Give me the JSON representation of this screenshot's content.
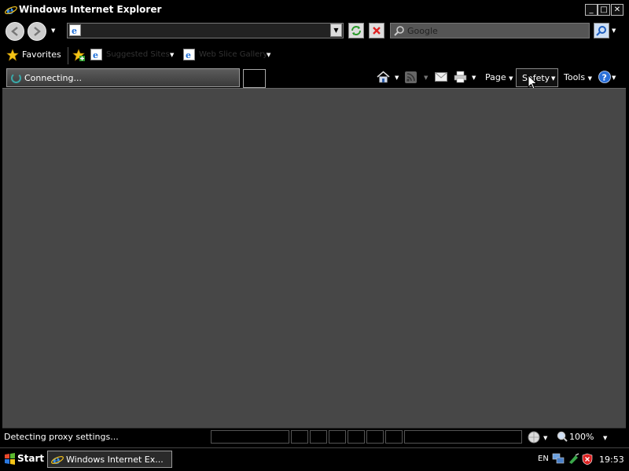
{
  "window": {
    "title": "Windows Internet Explorer",
    "minimize": "_",
    "maximize": "□",
    "close": "✕"
  },
  "nav": {
    "address_value": "",
    "search_placeholder": "Google"
  },
  "favorites": {
    "favorites_label": "Favorites",
    "items": [
      {
        "label": "Suggested Sites"
      },
      {
        "label": "Web Slice Gallery"
      }
    ]
  },
  "tab": {
    "label": "Connecting..."
  },
  "commands": {
    "page": "Page",
    "safety": "Safety",
    "tools": "Tools"
  },
  "status": {
    "text": "Detecting proxy settings...",
    "zoom": "100%"
  },
  "taskbar": {
    "start": "Start",
    "task_label": "Windows Internet Ex...",
    "language": "EN",
    "clock": "19:53"
  },
  "colors": {
    "content_bg": "#474747",
    "chrome_bg": "#000000",
    "ie_blue": "#1e6fd9"
  }
}
